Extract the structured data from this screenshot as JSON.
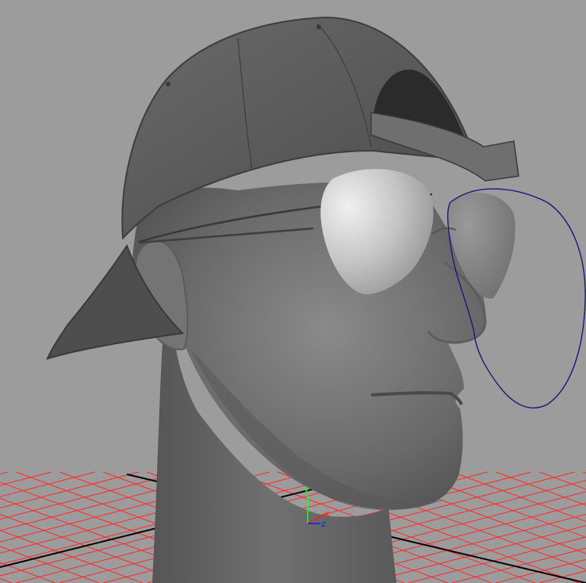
{
  "viewport": {
    "background_color": "#9c9c9c",
    "grid_color": "#ff2a2a",
    "grid_axis_color": "#000000",
    "selection_color": "#1a1a7a",
    "scene_objects": [
      "head-model",
      "baseball-cap",
      "aviator-sunglasses",
      "selected-lens-curve",
      "ground-grid"
    ]
  },
  "axis_gizmo": {
    "y_label": "y",
    "x_label": "x",
    "z_label": "z",
    "y_color": "#19ff19",
    "x_color": "#ff1a1a",
    "z_color": "#1a1aff"
  }
}
